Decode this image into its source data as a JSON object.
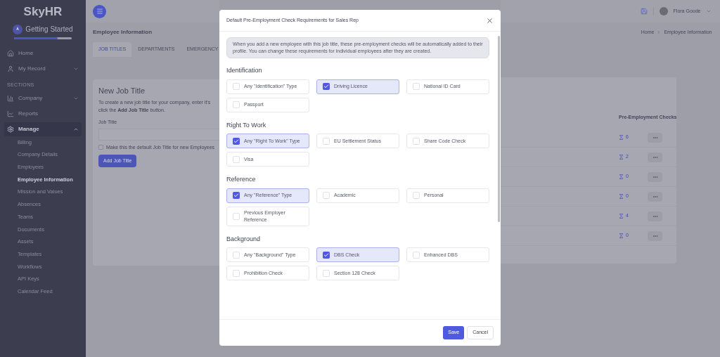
{
  "sidebar": {
    "logo": "SkyHR",
    "getting_started": {
      "label": "Getting Started",
      "level": 0.75
    },
    "nav": [
      {
        "kind": "link",
        "label": "Home"
      },
      {
        "kind": "group",
        "label": "My Record",
        "expanded": false
      },
      {
        "kind": "heading",
        "label": "SECTIONS"
      },
      {
        "kind": "group",
        "label": "Company",
        "expanded": false
      },
      {
        "kind": "link",
        "label": "Reports"
      },
      {
        "kind": "group",
        "label": "Manage",
        "expanded": true,
        "children": [
          {
            "label": "Billing",
            "selected": false
          },
          {
            "label": "Company Details",
            "selected": false
          },
          {
            "label": "Employees",
            "selected": false
          },
          {
            "label": "Employee Information",
            "selected": true
          },
          {
            "label": "Mission and Values",
            "selected": false
          },
          {
            "label": "Absences",
            "selected": false
          },
          {
            "label": "Teams",
            "selected": false
          },
          {
            "label": "Documents",
            "selected": false
          },
          {
            "label": "Assets",
            "selected": false
          },
          {
            "label": "Templates",
            "selected": false
          },
          {
            "label": "Workflows",
            "selected": false
          },
          {
            "label": "API Keys",
            "selected": false
          },
          {
            "label": "Calendar Feed",
            "selected": false
          }
        ]
      }
    ]
  },
  "header": {
    "user": "Flora Goode"
  },
  "page": {
    "title": "Employee Information",
    "breadcrumb": [
      "Home",
      "Employee Information"
    ],
    "tabs": [
      {
        "label": "JOB TITLES",
        "selected": true
      },
      {
        "label": "DEPARTMENTS",
        "selected": false
      },
      {
        "label": "EMERGENCY",
        "selected": false
      }
    ]
  },
  "new_job_title": {
    "title": "New Job Title",
    "description": "To create a new job title for your company, enter it's",
    "description_2": "click the **Add Job Title** button.",
    "field_label": "Job Title",
    "default_checkbox": {
      "label": "Make this the default Job Title for new Employees",
      "checked": false
    },
    "button": "Add Job Title"
  },
  "table": {
    "column": "Pre-Employment Checks",
    "rows": [
      {
        "checks": "6"
      },
      {
        "checks": "2"
      },
      {
        "checks": "0"
      },
      {
        "checks": "0"
      },
      {
        "checks": "4"
      },
      {
        "checks": "0"
      }
    ]
  },
  "modal": {
    "title": "Default Pre-Employment Check Requirements for Sales Rep",
    "info": "When you add a new employee with this job title, these pre-employment checks will be automatically added to their profile. You can change these requirements for individual employees after they are created.",
    "sections": [
      {
        "title": "Identification",
        "options": [
          {
            "label": "Any \"Identification\" Type",
            "checked": false
          },
          {
            "label": "Driving Licence",
            "checked": true
          },
          {
            "label": "National ID Card",
            "checked": false
          },
          {
            "label": "Passport",
            "checked": false
          }
        ]
      },
      {
        "title": "Right To Work",
        "options": [
          {
            "label": "Any \"Right To Work\" Type",
            "checked": true
          },
          {
            "label": "EU Settlement Status",
            "checked": false
          },
          {
            "label": "Share Code Check",
            "checked": false
          },
          {
            "label": "Visa",
            "checked": false
          }
        ]
      },
      {
        "title": "Reference",
        "options": [
          {
            "label": "Any \"Reference\" Type",
            "checked": true
          },
          {
            "label": "Academic",
            "checked": false
          },
          {
            "label": "Personal",
            "checked": false
          },
          {
            "label": "Previous Employer Reference",
            "checked": false
          }
        ]
      },
      {
        "title": "Background",
        "options": [
          {
            "label": "Any \"Background\" Type",
            "checked": false
          },
          {
            "label": "DBS Check",
            "checked": true
          },
          {
            "label": "Enhanced DBS",
            "checked": false
          },
          {
            "label": "Prohibition Check",
            "checked": false
          },
          {
            "label": "Section 128 Check",
            "checked": false
          }
        ]
      }
    ],
    "buttons": [
      {
        "label": "Save",
        "kind": "primary"
      },
      {
        "label": "Cancel",
        "kind": "secondary"
      }
    ]
  }
}
